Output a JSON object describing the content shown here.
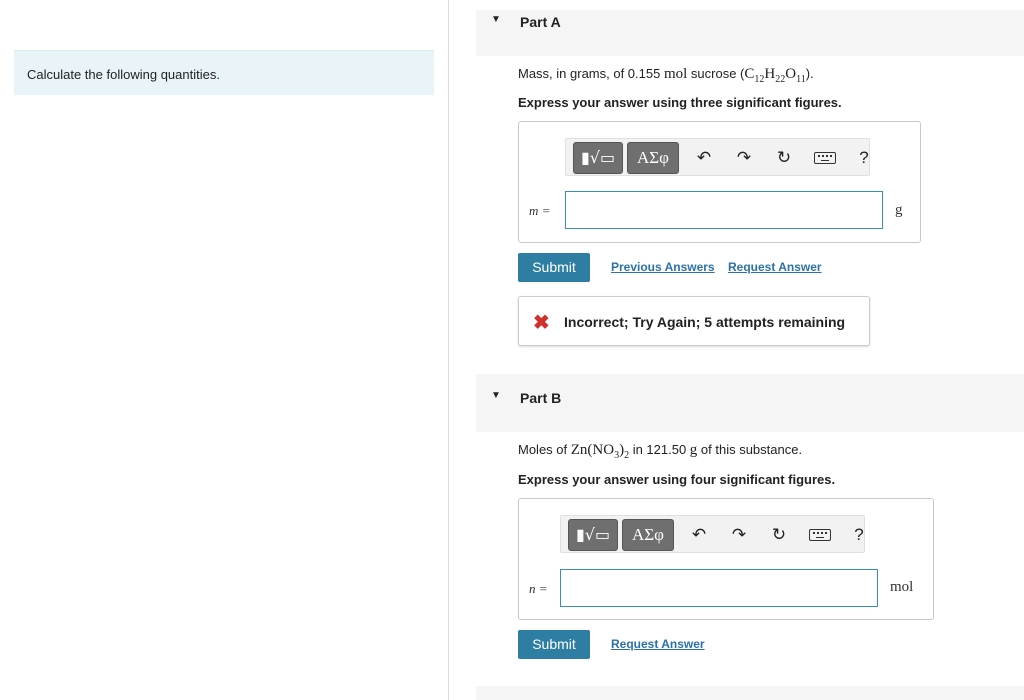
{
  "intro": {
    "text": "Calculate the following quantities."
  },
  "toolbar": {
    "template_glyph": "▮√▭",
    "greek_glyph": "ΑΣφ",
    "undo_glyph": "↶",
    "redo_glyph": "↷",
    "reset_glyph": "↻",
    "help_glyph": "?"
  },
  "partA": {
    "title": "Part A",
    "q_prefix": "Mass, in grams, of 0.155 ",
    "q_mol": "mol",
    "q_mid": " sucrose (",
    "q_f1": "C",
    "q_s1": "12",
    "q_f2": "H",
    "q_s2": "22",
    "q_f3": "O",
    "q_s3": "11",
    "q_end": ").",
    "instruction": "Express your answer using three significant figures.",
    "var_label": "m =",
    "input_value": "",
    "unit": "g",
    "submit": "Submit",
    "previous_answers": "Previous Answers",
    "request_answer": "Request Answer",
    "feedback_icon": "✖",
    "feedback": "Incorrect; Try Again; 5 attempts remaining"
  },
  "partB": {
    "title": "Part B",
    "q_prefix": "Moles of ",
    "q_formula_a": "Zn(NO",
    "q_sub_a": "3",
    "q_formula_b": ")",
    "q_sub_b": "2",
    "q_mid": " in 121.50 ",
    "q_unit": "g",
    "q_end": " of this substance.",
    "instruction": "Express your answer using four significant figures.",
    "var_label": "n =",
    "input_value": "",
    "unit": "mol",
    "submit": "Submit",
    "request_answer": "Request Answer"
  },
  "colors": {
    "accent": "#2d7ea2",
    "link": "#2b72a8",
    "error": "#d0312d",
    "intro_bg": "#e8f4f8"
  }
}
